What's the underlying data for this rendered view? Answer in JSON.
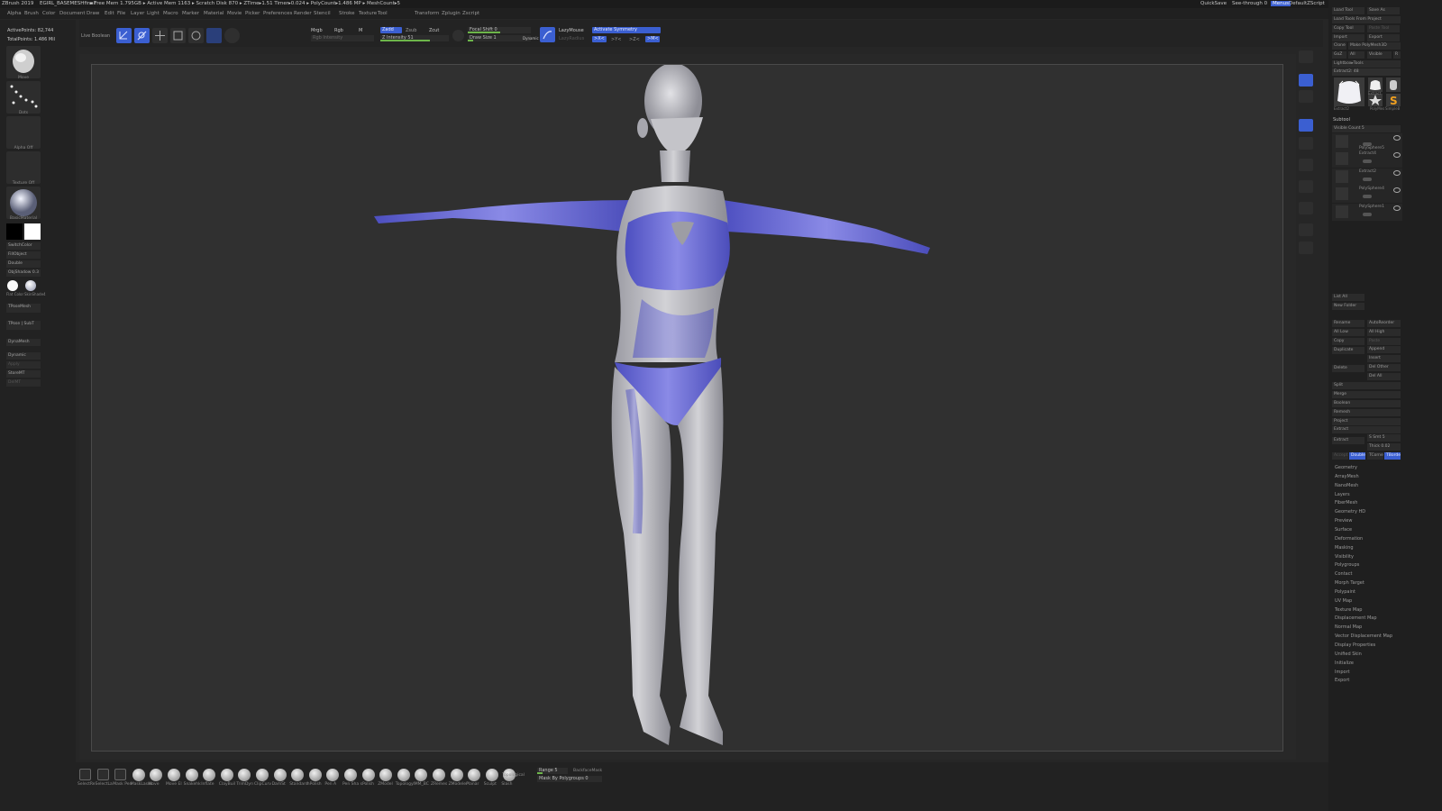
{
  "app": {
    "title": "ZBrush 2019",
    "file": "EGIRL_BASEMESHfinal",
    "stats": "▸ Free Mem 1.795GB ▸ Active Mem 1163 ▸ Scratch Disk 870 ▸ ZTime▸1.51 Timer▸0.024 ▸ PolyCount▸1.486 MP ▸ MeshCount▸5",
    "quicksave": "QuickSave",
    "seethrough": "See-through 0",
    "menu_btn": "Menus",
    "script": "DefaultZScript"
  },
  "menu": [
    "Alpha",
    "Brush",
    "Color",
    "Document",
    "Draw",
    "Edit",
    "File",
    "Layer",
    "Light",
    "Macro",
    "Marker",
    "Material",
    "Movie",
    "Picker",
    "Preferences",
    "Render",
    "Stencil",
    "Stroke",
    "Texture",
    "Tool",
    "Transform",
    "Zplugin",
    "Zscript"
  ],
  "toolbar": {
    "live_boolean": "Live Boolean",
    "edit": "Edit",
    "draw": "Draw",
    "move": "Move",
    "scale": "Scale",
    "rotate": "Rotate",
    "mrgb": "Mrgb",
    "rgb": "Rgb",
    "m": "M",
    "zadd": "Zadd",
    "zsub": "Zsub",
    "zcut": "Zcut",
    "rgb_intensity": "Rgb Intensity",
    "z_intensity": "Z Intensity 51",
    "focal_shift": "Focal Shift 0",
    "draw_size": "Draw Size 1",
    "dynamic": "Dynamic",
    "lazymouse": "LazyMouse",
    "lazyradius": "LazyRadius",
    "activate_symmetry": "Activate Symmetry",
    "sym_x": ">X<",
    "sym_y": ">Y<",
    "sym_z": ">Z<",
    "sym_m": ">M<"
  },
  "left": {
    "active_points": "ActivePoints: 82,744",
    "total_points": "TotalPoints: 1.486 Mil",
    "brush_label": "Move",
    "stroke_label": "Dots",
    "alpha_label": "Alpha Off",
    "texture_label": "Texture Off",
    "material_label": "BasicMaterial",
    "switch_color": "SwitchColor",
    "fill_object": "FillObject",
    "double": "Double",
    "obj_shadow": "ObjShadow 0.3",
    "flat_color": "Flat Color",
    "skinshade": "SkinShade4",
    "tpose_mesh": "TPoseMesh",
    "tpose_subt": "TPose | SubT",
    "dynamesh": "DynaMesh",
    "dynamic": "Dynamic",
    "apply": "Apply",
    "store_mt": "StoreMT",
    "del_mt": "DelMT"
  },
  "right_top": {
    "load_tool": "Load Tool",
    "save_as": "Save As",
    "load_from_project": "Load Tools From Project",
    "copy_tool": "Copy Tool",
    "paste_tool": "Paste Tool",
    "import": "Import",
    "export": "Export",
    "clone": "Clone",
    "make_polymesh": "Make PolyMesh3D",
    "goz": "GoZ",
    "all": "All",
    "visible": "Visible",
    "r": "R",
    "lightbox_tools": "Lightbox▸Tools",
    "current_tool": "Extract2: 48",
    "thumbs": [
      "Extract2",
      "Extract",
      "PolyMes",
      "SimpleB"
    ]
  },
  "subtool": {
    "title": "Subtool",
    "visible_count": "Visible Count 5",
    "items": [
      "PolySphere5",
      "Extract4",
      "Extract2",
      "PolySphere4",
      "PolySphere1"
    ]
  },
  "subtool_ops": {
    "list_all": "List All",
    "new_folder": "New Folder",
    "rename": "Rename",
    "auto_reorder": "AutoReorder",
    "all_low": "All Low",
    "all_high": "All High",
    "copy": "Copy",
    "paste": "Paste",
    "duplicate": "Duplicate",
    "append": "Append",
    "insert": "Insert",
    "delete": "Delete",
    "del_other": "Del Other",
    "del_all": "Del All",
    "split": "Split",
    "merge": "Merge",
    "boolean": "Boolean",
    "remesh": "Remesh",
    "project": "Project",
    "extract": "Extract",
    "extract_btn": "Extract",
    "smooth": "S Smt 5",
    "thick": "Thick 0.02",
    "accept": "Accept",
    "double": "Double",
    "tcorne": "TCorne",
    "tborder": "TBorder"
  },
  "subpalettes": [
    "Geometry",
    "ArrayMesh",
    "NanoMesh",
    "Layers",
    "FiberMesh",
    "Geometry HD",
    "Preview",
    "Surface",
    "Deformation",
    "Masking",
    "Visibility",
    "Polygroups",
    "Contact",
    "Morph Target",
    "Polypaint",
    "UV Map",
    "Texture Map",
    "Displacement Map",
    "Normal Map",
    "Vector Displacement Map",
    "Display Properties",
    "Unified Skin",
    "Initialize",
    "Import",
    "Export"
  ],
  "rightnav": [
    "BPR",
    "SPix 3",
    "Scroll",
    "Zoom",
    "Actual",
    "AAHalf",
    "Persp",
    "Floor",
    "Local",
    "Frame",
    "Move",
    "Scale",
    "Rotate",
    "Transp",
    "Solo",
    "Xpose"
  ],
  "bottom": {
    "brushes": [
      "SelectRe",
      "SelectLa",
      "Mask Pen",
      "MaskLasso",
      "Move",
      "Move El",
      "Snakehk",
      "Inflate",
      "ClayBuil",
      "TrimDyn",
      "ClipCurv",
      "DamSt",
      "Standard",
      "hPolish",
      "Pen A",
      "Pen Sha",
      "sPolish",
      "ZModel",
      "Topology",
      "IMM_BC",
      "ZRemes",
      "ZModeler",
      "Planar",
      "Sculpt",
      "Slash"
    ],
    "topological": "Topological",
    "range": "Range 5",
    "backface": "BackfaceMask",
    "mask_by_polygroups": "Mask By Polygroups 0"
  }
}
